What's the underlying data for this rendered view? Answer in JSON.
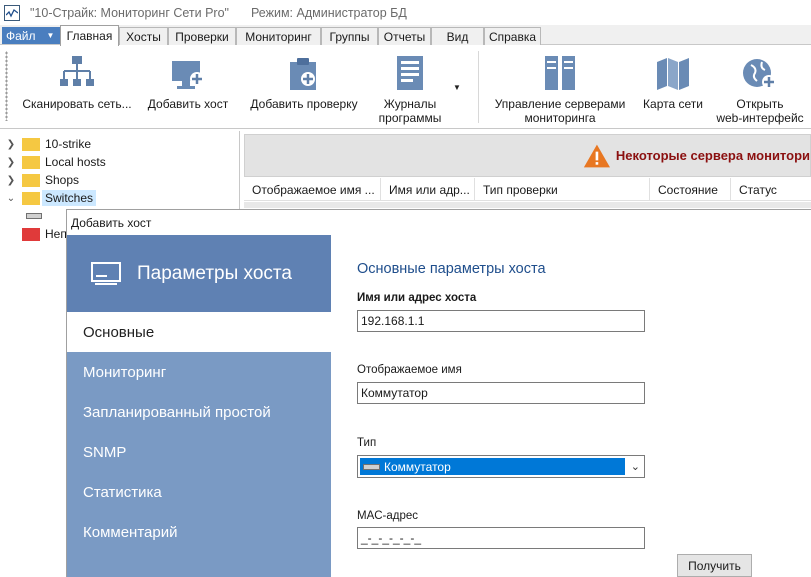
{
  "window": {
    "title": "\"10-Страйк: Мониторинг Сети Pro\"",
    "mode": "Режим: Администратор БД"
  },
  "ribbon_tabs": [
    "Файл",
    "Главная",
    "Хосты",
    "Проверки",
    "Мониторинг",
    "Группы",
    "Отчеты",
    "Вид",
    "Справка"
  ],
  "ribbon": {
    "scan": "Сканировать сеть...",
    "add_host": "Добавить хост",
    "add_check": "Добавить проверку",
    "logs_line1": "Журналы",
    "logs_line2": "программы",
    "manage_line1": "Управление серверами",
    "manage_line2": "мониторинга",
    "map": "Карта сети",
    "web_line1": "Открыть",
    "web_line2": "web-интерфейс"
  },
  "tree": {
    "items": [
      "10-strike",
      "Local hosts",
      "Shops",
      "Switches"
    ],
    "partial_item": "Неп"
  },
  "banner": "Некоторые сервера монитори",
  "table_headers": [
    "Отображаемое имя ...",
    "Имя или адр...",
    "Тип проверки",
    "Состояние",
    "Статус"
  ],
  "dialog": {
    "title": "Добавить хост",
    "sidebar_title": "Параметры хоста",
    "nav": [
      "Основные",
      "Мониторинг",
      "Запланированный простой",
      "SNMP",
      "Статистика",
      "Комментарий"
    ],
    "form_title": "Основные параметры хоста",
    "host_label": "Имя или адрес хоста",
    "host_value": "192.168.1.1",
    "display_label": "Отображаемое имя",
    "display_value": "Коммутатор",
    "type_label": "Тип",
    "type_value": "Коммутатор",
    "mac_label": "MAC-адрес",
    "mac_value": "_-_-_-_-_-_",
    "get_button": "Получить"
  },
  "colors": {
    "file_tab": "#4a7ebf",
    "folder_yellow": "#f5c842",
    "folder_red": "#e03a3a",
    "sidebar": "#7a9ac4",
    "sidebar_head": "#5f81b3",
    "warning": "#e87722",
    "banner_text": "#8b1010",
    "form_heading": "#1f4e8c",
    "select_highlight": "#0078d7"
  },
  "icons": [
    "scan-network-icon",
    "add-host-icon",
    "add-check-icon",
    "logs-icon",
    "servers-icon",
    "network-map-icon",
    "web-interface-icon",
    "folder-icon",
    "switch-icon",
    "warning-icon",
    "monitor-icon",
    "chevron-down-icon"
  ]
}
